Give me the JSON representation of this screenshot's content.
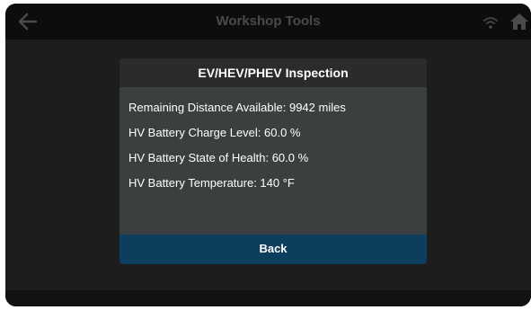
{
  "app": {
    "title": "Workshop Tools",
    "icons": {
      "back": "arrow-left-icon",
      "wifi": "wifi-icon",
      "home": "home-icon"
    }
  },
  "dialog": {
    "title": "EV/HEV/PHEV Inspection",
    "lines": [
      "Remaining Distance Available: 9942 miles",
      "HV Battery Charge Level: 60.0 %",
      "HV Battery State of Health: 60.0 %",
      "HV Battery Temperature: 140 °F"
    ],
    "back_label": "Back"
  },
  "colors": {
    "dialog_header": "#2b2b2b",
    "dialog_body": "#3c3f40",
    "back_button": "#0e3e5e",
    "dimmed_text": "#4a4a4a"
  }
}
